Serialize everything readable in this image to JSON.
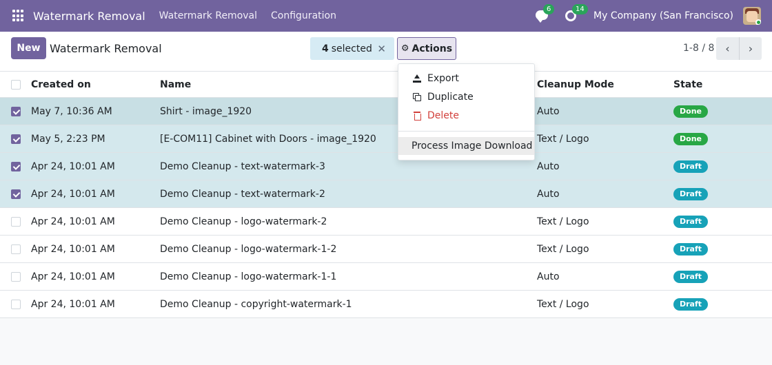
{
  "navbar": {
    "app_name": "Watermark Removal",
    "menu": [
      "Watermark Removal",
      "Configuration"
    ],
    "messages_count": "6",
    "activities_count": "14",
    "company": "My Company (San Francisco)"
  },
  "control": {
    "new_label": "New",
    "title": "Watermark Removal",
    "selected_count": "4",
    "selected_label": "selected",
    "clear_selection": "✕",
    "actions_label": "Actions",
    "pager": "1-8 / 8",
    "prev": "‹",
    "next": "›"
  },
  "actions_menu": {
    "export": "Export",
    "duplicate": "Duplicate",
    "delete": "Delete",
    "process": "Process Image Download"
  },
  "table": {
    "columns": [
      "Created on",
      "Name",
      "Cleanup Mode",
      "State"
    ],
    "rows": [
      {
        "checked": true,
        "created": "May 7, 10:36 AM",
        "name": "Shirt - image_1920",
        "mode": "Auto",
        "state": "Done"
      },
      {
        "checked": true,
        "created": "May 5, 2:23 PM",
        "name": "[E-COM11] Cabinet with Doors - image_1920",
        "mode": "Text / Logo",
        "state": "Done"
      },
      {
        "checked": true,
        "created": "Apr 24, 10:01 AM",
        "name": "Demo Cleanup - text-watermark-3",
        "mode": "Auto",
        "state": "Draft"
      },
      {
        "checked": true,
        "created": "Apr 24, 10:01 AM",
        "name": "Demo Cleanup - text-watermark-2",
        "mode": "Auto",
        "state": "Draft"
      },
      {
        "checked": false,
        "created": "Apr 24, 10:01 AM",
        "name": "Demo Cleanup - logo-watermark-2",
        "mode": "Text / Logo",
        "state": "Draft"
      },
      {
        "checked": false,
        "created": "Apr 24, 10:01 AM",
        "name": "Demo Cleanup - logo-watermark-1-2",
        "mode": "Text / Logo",
        "state": "Draft"
      },
      {
        "checked": false,
        "created": "Apr 24, 10:01 AM",
        "name": "Demo Cleanup - logo-watermark-1-1",
        "mode": "Auto",
        "state": "Draft"
      },
      {
        "checked": false,
        "created": "Apr 24, 10:01 AM",
        "name": "Demo Cleanup - copyright-watermark-1",
        "mode": "Text / Logo",
        "state": "Draft"
      }
    ]
  },
  "colors": {
    "brand": "#71639e",
    "done": "#28a745",
    "draft": "#17a2b8",
    "selected_row": "#d4e8ed"
  }
}
